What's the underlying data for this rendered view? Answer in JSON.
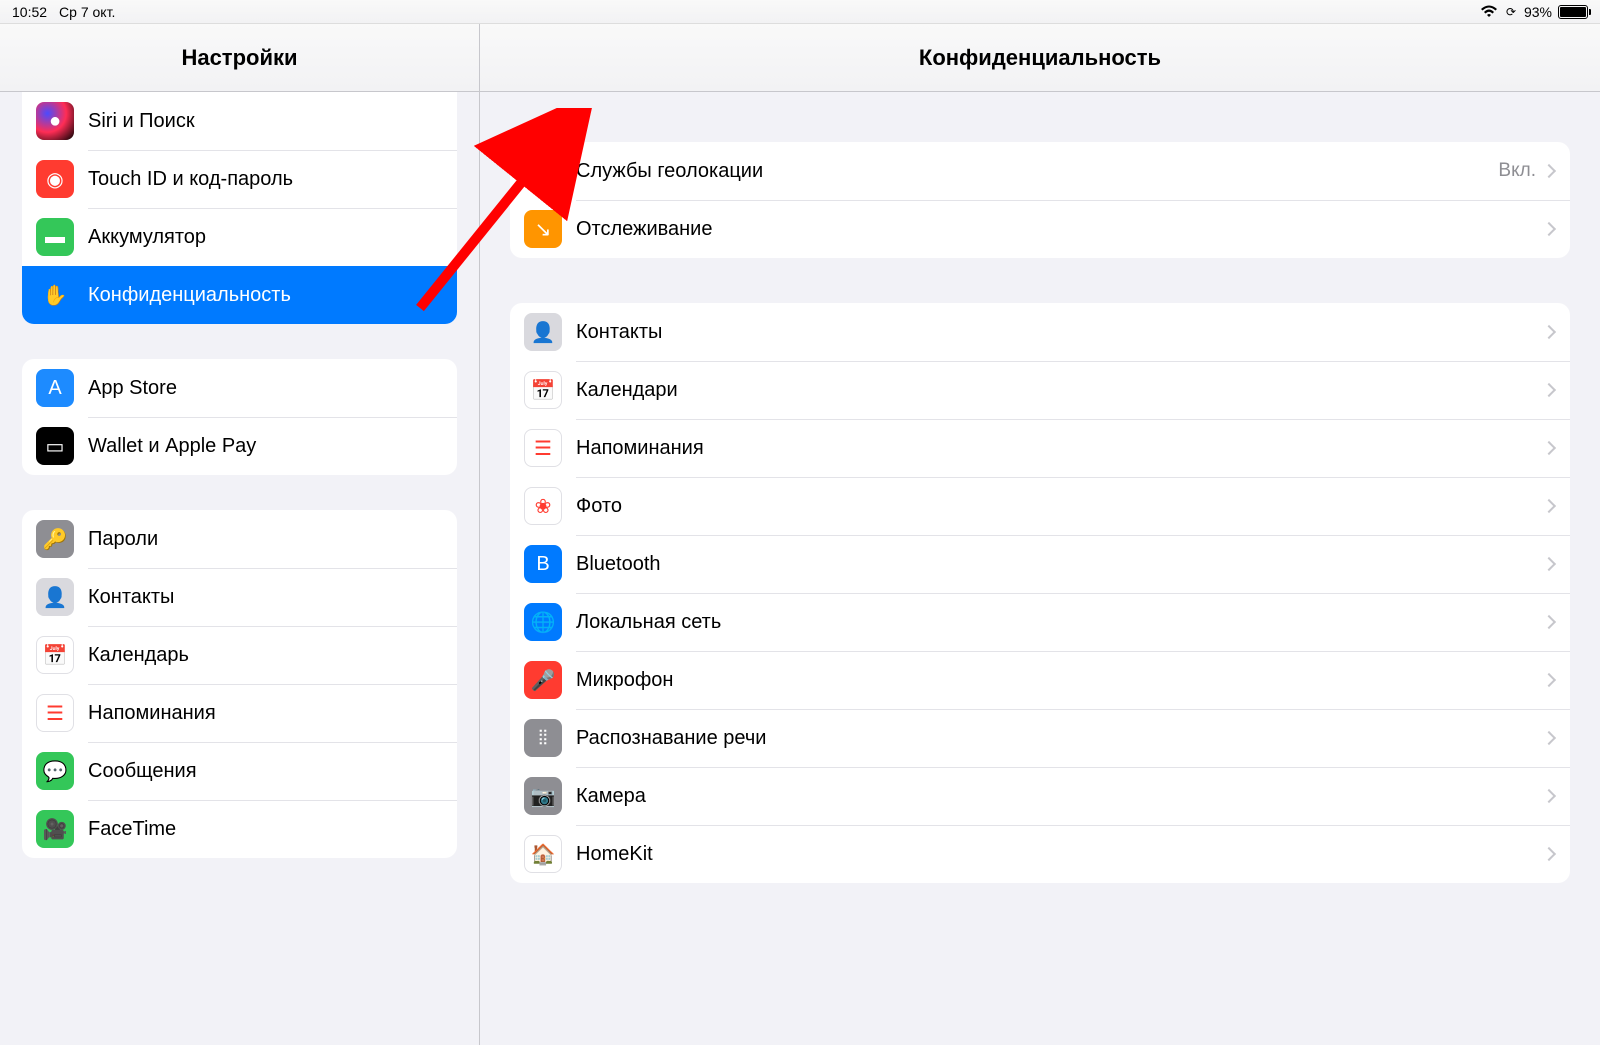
{
  "status": {
    "time": "10:52",
    "date": "Ср 7 окт.",
    "battery": "93%"
  },
  "sidebar": {
    "title": "Настройки",
    "groups": [
      {
        "items": [
          {
            "label": "Siri и Поиск",
            "icon": "siri",
            "name": "sidebar-item-siri"
          },
          {
            "label": "Touch ID и код-пароль",
            "icon": "touchid",
            "name": "sidebar-item-touchid"
          },
          {
            "label": "Аккумулятор",
            "icon": "battery",
            "name": "sidebar-item-battery"
          },
          {
            "label": "Конфиденциальность",
            "icon": "hand",
            "name": "sidebar-item-privacy",
            "selected": true
          }
        ]
      },
      {
        "items": [
          {
            "label": "App Store",
            "icon": "appstore",
            "name": "sidebar-item-appstore"
          },
          {
            "label": "Wallet и Apple Pay",
            "icon": "wallet",
            "name": "sidebar-item-wallet"
          }
        ]
      },
      {
        "items": [
          {
            "label": "Пароли",
            "icon": "key",
            "name": "sidebar-item-passwords"
          },
          {
            "label": "Контакты",
            "icon": "contacts",
            "name": "sidebar-item-contacts"
          },
          {
            "label": "Календарь",
            "icon": "calendar",
            "name": "sidebar-item-calendar"
          },
          {
            "label": "Напоминания",
            "icon": "reminders",
            "name": "sidebar-item-reminders"
          },
          {
            "label": "Сообщения",
            "icon": "messages",
            "name": "sidebar-item-messages"
          },
          {
            "label": "FaceTime",
            "icon": "facetime",
            "name": "sidebar-item-facetime"
          }
        ]
      }
    ]
  },
  "content": {
    "title": "Конфиденциальность",
    "groups": [
      {
        "items": [
          {
            "label": "Службы геолокации",
            "value": "Вкл.",
            "icon": "location",
            "name": "row-location"
          },
          {
            "label": "Отслеживание",
            "icon": "tracking",
            "name": "row-tracking"
          }
        ]
      },
      {
        "items": [
          {
            "label": "Контакты",
            "icon": "contacts",
            "name": "row-contacts"
          },
          {
            "label": "Календари",
            "icon": "calendar",
            "name": "row-calendars"
          },
          {
            "label": "Напоминания",
            "icon": "reminders",
            "name": "row-reminders"
          },
          {
            "label": "Фото",
            "icon": "photos",
            "name": "row-photos"
          },
          {
            "label": "Bluetooth",
            "icon": "bluetooth",
            "name": "row-bluetooth"
          },
          {
            "label": "Локальная сеть",
            "icon": "localnet",
            "name": "row-localnet"
          },
          {
            "label": "Микрофон",
            "icon": "mic",
            "name": "row-mic"
          },
          {
            "label": "Распознавание речи",
            "icon": "speech",
            "name": "row-speech"
          },
          {
            "label": "Камера",
            "icon": "camera",
            "name": "row-camera"
          },
          {
            "label": "HomeKit",
            "icon": "homekit",
            "name": "row-homekit"
          }
        ]
      }
    ]
  },
  "icons": {
    "siri": {
      "bg": "radial-gradient(circle at 30% 30%, #4b4bff, #ff2d55, #000)",
      "glyph": "●"
    },
    "touchid": {
      "bg": "#ff3b30",
      "glyph": "◉"
    },
    "battery": {
      "bg": "#34c759",
      "glyph": "▬"
    },
    "hand": {
      "bg": "#007aff",
      "glyph": "✋"
    },
    "appstore": {
      "bg": "#1d8bff",
      "glyph": "A"
    },
    "wallet": {
      "bg": "#000",
      "glyph": "▭"
    },
    "key": {
      "bg": "#8e8e93",
      "glyph": "🔑"
    },
    "contacts": {
      "bg": "#d9d9de",
      "glyph": "👤"
    },
    "calendar": {
      "bg": "#fff",
      "glyph": "📅",
      "border": true
    },
    "reminders": {
      "bg": "#fff",
      "glyph": "☰",
      "border": true
    },
    "messages": {
      "bg": "#34c759",
      "glyph": "💬"
    },
    "facetime": {
      "bg": "#34c759",
      "glyph": "🎥"
    },
    "location": {
      "bg": "#007aff",
      "glyph": "➤"
    },
    "tracking": {
      "bg": "#ff9500",
      "glyph": "↘"
    },
    "photos": {
      "bg": "#fff",
      "glyph": "❀",
      "border": true
    },
    "bluetooth": {
      "bg": "#007aff",
      "glyph": "B"
    },
    "localnet": {
      "bg": "#007aff",
      "glyph": "🌐"
    },
    "mic": {
      "bg": "#ff3b30",
      "glyph": "🎤"
    },
    "speech": {
      "bg": "#8e8e93",
      "glyph": "⦙⦙"
    },
    "camera": {
      "bg": "#8e8e93",
      "glyph": "📷"
    },
    "homekit": {
      "bg": "#fff",
      "glyph": "🏠",
      "border": true
    }
  }
}
